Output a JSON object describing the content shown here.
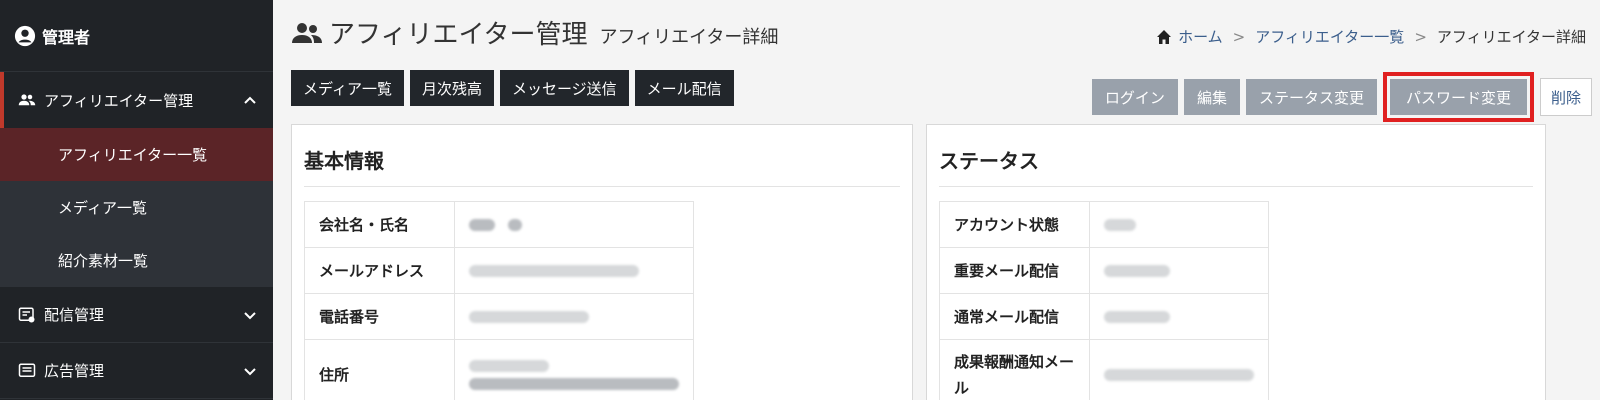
{
  "sidebar": {
    "user_label": "管理者",
    "groups": [
      {
        "label": "アフィリエイター管理",
        "icon": "users-icon",
        "expanded": true,
        "items": [
          {
            "label": "アフィリエイター一覧",
            "active": true
          },
          {
            "label": "メディア一覧",
            "active": false
          },
          {
            "label": "紹介素材一覧",
            "active": false
          }
        ]
      },
      {
        "label": "配信管理",
        "icon": "mail-settings-icon",
        "expanded": false
      },
      {
        "label": "広告管理",
        "icon": "list-icon",
        "expanded": false
      }
    ]
  },
  "header": {
    "title": "アフィリエイター管理",
    "subtitle": "アフィリエイター詳細",
    "breadcrumb": [
      "ホーム",
      "アフィリエイター一覧",
      "アフィリエイター詳細"
    ]
  },
  "actions_left": [
    "メディア一覧",
    "月次残高",
    "メッセージ送信",
    "メール配信"
  ],
  "actions_right": {
    "login": "ログイン",
    "edit": "編集",
    "status_change": "ステータス変更",
    "password_change": "パスワード変更",
    "delete": "削除"
  },
  "basic_info": {
    "title": "基本情報",
    "rows": [
      {
        "key": "会社名・氏名"
      },
      {
        "key": "メールアドレス"
      },
      {
        "key": "電話番号"
      },
      {
        "key": "住所"
      }
    ]
  },
  "status": {
    "title": "ステータス",
    "rows": [
      {
        "key": "アカウント状態"
      },
      {
        "key": "重要メール配信"
      },
      {
        "key": "通常メール配信"
      },
      {
        "key": "成果報酬通知メール"
      }
    ]
  },
  "colors": {
    "sidebar_bg": "#202327",
    "active_item_bg": "#5b2427",
    "highlight_border": "#e02020",
    "link": "#3b5e8c"
  }
}
